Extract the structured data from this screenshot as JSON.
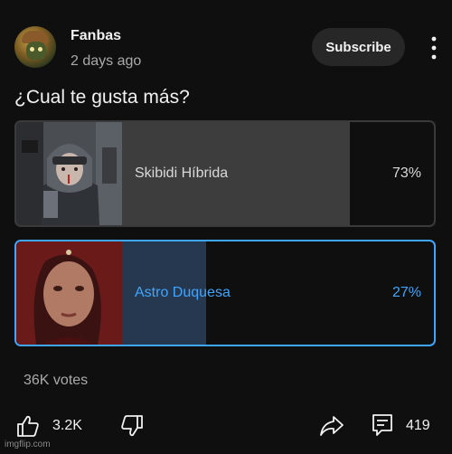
{
  "post": {
    "channel_name": "Fanbas",
    "time_ago": "2 days ago",
    "subscribe_label": "Subscribe",
    "question": "¿Cual te gusta más?"
  },
  "poll": {
    "options": [
      {
        "label": "Skibidi Híbrida",
        "percent_text": "73%",
        "percent": 73,
        "selected": false
      },
      {
        "label": "Astro Duquesa",
        "percent_text": "27%",
        "percent": 27,
        "selected": true
      }
    ],
    "votes": "36K votes"
  },
  "actions": {
    "like_count": "3.2K",
    "comment_count": "419",
    "icons": [
      "thumbs-up-icon",
      "thumbs-down-icon",
      "share-icon",
      "comment-icon",
      "more-vertical-icon"
    ]
  },
  "colors": {
    "background": "#0f0f0f",
    "accent_blue": "#3ea6ff",
    "text_primary": "#f1f1f1",
    "text_secondary": "#aaaaaa"
  },
  "watermark": "imgflip.com"
}
